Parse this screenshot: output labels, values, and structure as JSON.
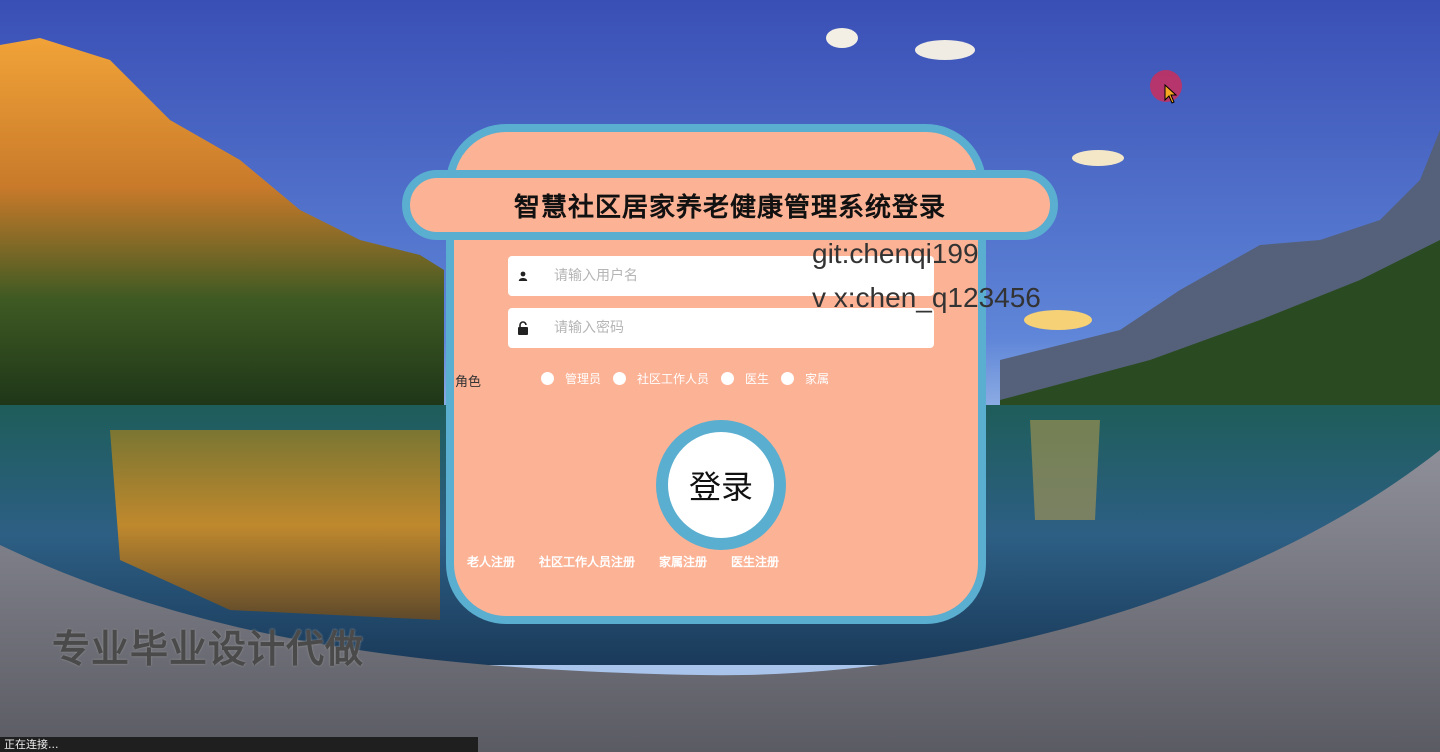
{
  "page": {
    "title": "智慧社区居家养老健康管理系统登录",
    "slogan": "专业毕业设计代做",
    "watermark_lines": [
      "git:chenqi199",
      "v x:chen_q123456"
    ],
    "status_text": "正在连接..."
  },
  "form": {
    "username_placeholder": "请输入用户名",
    "username_value": "",
    "password_placeholder": "请输入密码",
    "password_value": "",
    "role_label": "角色",
    "roles": [
      "管理员",
      "社区工作人员",
      "医生",
      "家属"
    ],
    "login_label": "登录",
    "register_links": [
      "老人注册",
      "社区工作人员注册",
      "家属注册",
      "医生注册"
    ]
  },
  "colors": {
    "card_bg": "#fcb295",
    "card_border": "#5aaed0",
    "sky_top": "#3c55b8",
    "lake": "#2e5e7a"
  },
  "icons": {
    "username": "user-icon",
    "password": "lock-icon",
    "cursor": "mouse-cursor-icon"
  }
}
